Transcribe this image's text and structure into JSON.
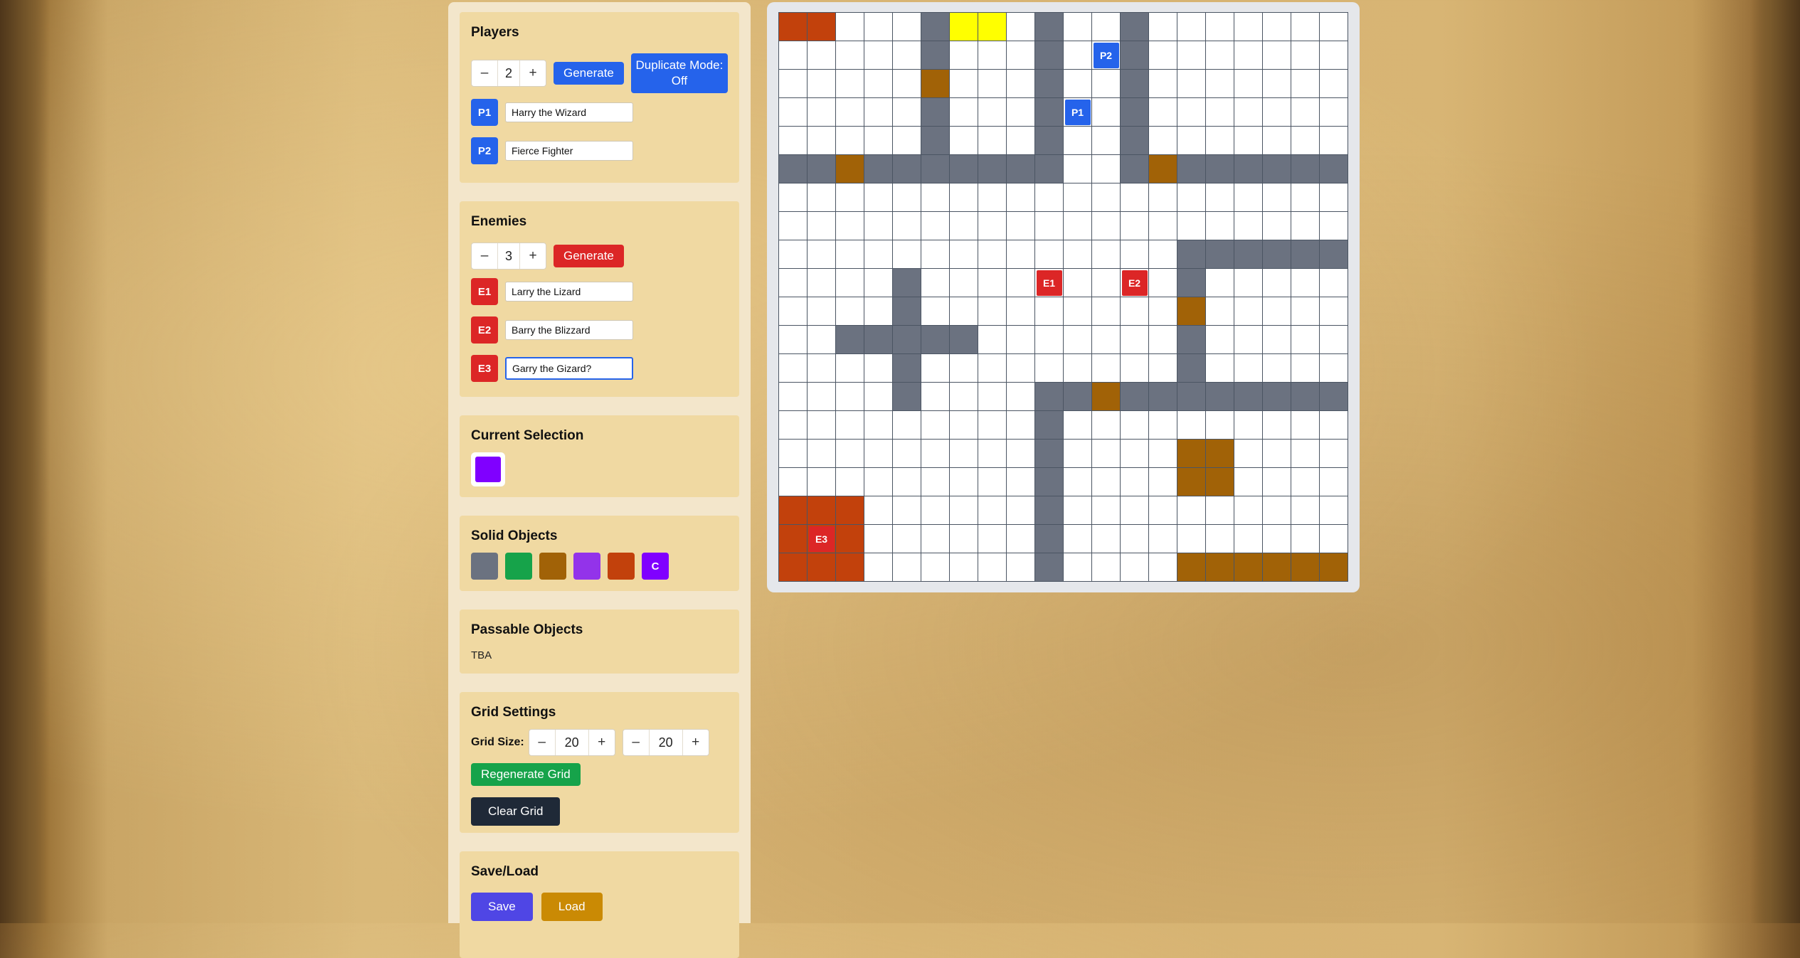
{
  "colors": {
    "wall": "#6b7280",
    "green": "#16a34a",
    "brown": "#a16207",
    "purple": "#9333ea",
    "orange": "#c2410c",
    "yellow": "#ffff00",
    "current": "#8000ff",
    "player": "#2563eb",
    "enemy": "#dc2626"
  },
  "players": {
    "title": "Players",
    "count": "2",
    "minus": "–",
    "plus": "+",
    "generate_label": "Generate",
    "duplicate_label": "Duplicate Mode: Off",
    "list": [
      {
        "id": "P1",
        "name": "Harry the Wizard"
      },
      {
        "id": "P2",
        "name": "Fierce Fighter"
      }
    ]
  },
  "enemies": {
    "title": "Enemies",
    "count": "3",
    "minus": "–",
    "plus": "+",
    "generate_label": "Generate",
    "list": [
      {
        "id": "E1",
        "name": "Larry the Lizard"
      },
      {
        "id": "E2",
        "name": "Barry the Blizzard"
      },
      {
        "id": "E3",
        "name": "Garry the Gizard?"
      }
    ]
  },
  "current_selection": {
    "title": "Current Selection",
    "color": "#8000ff"
  },
  "solid_objects": {
    "title": "Solid Objects",
    "swatches": [
      {
        "color": "#6b7280",
        "label": ""
      },
      {
        "color": "#16a34a",
        "label": ""
      },
      {
        "color": "#a16207",
        "label": ""
      },
      {
        "color": "#9333ea",
        "label": ""
      },
      {
        "color": "#c2410c",
        "label": ""
      },
      {
        "color": "#8000ff",
        "label": "C"
      }
    ]
  },
  "passable_objects": {
    "title": "Passable Objects",
    "text": "TBA"
  },
  "grid_settings": {
    "title": "Grid Settings",
    "size_label": "Grid Size:",
    "width": "20",
    "height": "20",
    "minus": "–",
    "plus": "+",
    "regenerate_label": "Regenerate Grid",
    "clear_label": "Clear Grid"
  },
  "save_load": {
    "title": "Save/Load",
    "save_label": "Save",
    "load_label": "Load"
  },
  "grid": {
    "cols": 20,
    "rows": 20,
    "legend": {
      ".": "empty",
      "#": "wall",
      "o": "orange",
      "b": "brown",
      "y": "yellow"
    },
    "map": [
      "oo...#yy.#..#.......",
      ".....#...#..#.......",
      ".....b...#..#.......",
      ".....#...#..#.......",
      ".....#...#..#.......",
      "##b#######..#b######",
      "....................",
      "....................",
      "..............######",
      "....#.........#.....",
      "....#.........b.....",
      "..#####.......#.....",
      "....#.........#.....",
      "....#....##b########",
      ".........#..........",
      ".........#....bb....",
      ".........#....bb....",
      "ooo......#..........",
      "ooo......#..........",
      "ooo......#....bbbbbb"
    ],
    "tokens": [
      {
        "label": "P2",
        "row": 1,
        "col": 11,
        "kind": "player"
      },
      {
        "label": "P1",
        "row": 3,
        "col": 10,
        "kind": "player"
      },
      {
        "label": "E1",
        "row": 9,
        "col": 9,
        "kind": "enemy"
      },
      {
        "label": "E2",
        "row": 9,
        "col": 12,
        "kind": "enemy"
      },
      {
        "label": "E3",
        "row": 18,
        "col": 1,
        "kind": "enemy"
      }
    ]
  }
}
